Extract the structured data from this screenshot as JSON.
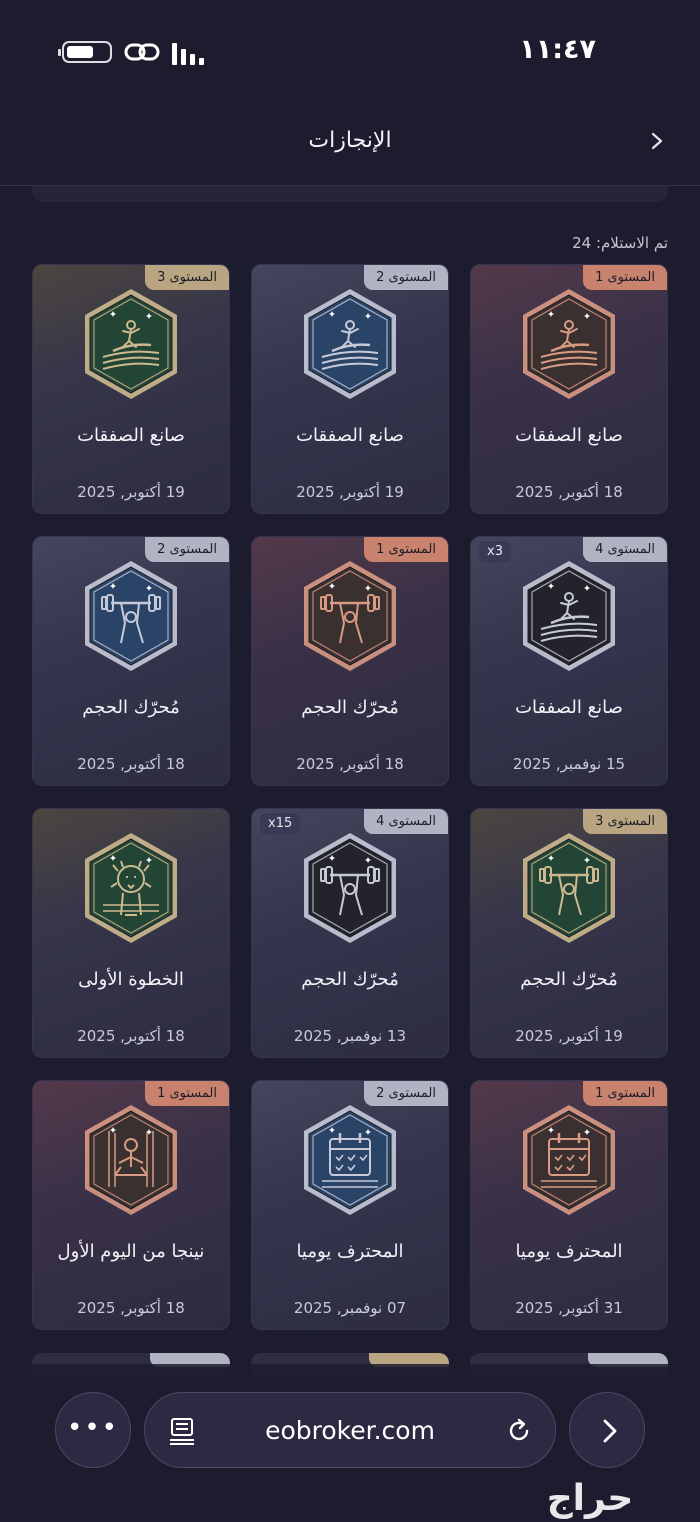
{
  "status_bar": {
    "time": "١١:٤٧"
  },
  "header": {
    "title": "الإنجازات"
  },
  "received_label": "تم الاستلام: 24",
  "achievements": [
    {
      "level": "المستوى 1",
      "tier": "bronze",
      "title": "صانع الصفقات",
      "date": "18 أكتوبر, 2025",
      "icon": "surfer-icon"
    },
    {
      "level": "المستوى 2",
      "tier": "silver",
      "title": "صانع الصفقات",
      "date": "19 أكتوبر, 2025",
      "icon": "surfer-icon"
    },
    {
      "level": "المستوى 3",
      "tier": "gold",
      "title": "صانع الصفقات",
      "date": "19 أكتوبر, 2025",
      "icon": "surfer-icon"
    },
    {
      "level": "المستوى 4",
      "tier": "silver",
      "count": "x3",
      "title": "صانع الصفقات",
      "date": "15 نوفمبر, 2025",
      "icon": "surfer-icon"
    },
    {
      "level": "المستوى 1",
      "tier": "bronze",
      "title": "مُحرّك الحجم",
      "date": "18 أكتوبر, 2025",
      "icon": "weightlifter-icon"
    },
    {
      "level": "المستوى 2",
      "tier": "silver",
      "title": "مُحرّك الحجم",
      "date": "18 أكتوبر, 2025",
      "icon": "weightlifter-icon"
    },
    {
      "level": "المستوى 3",
      "tier": "gold",
      "title": "مُحرّك الحجم",
      "date": "19 أكتوبر, 2025",
      "icon": "weightlifter-icon"
    },
    {
      "level": "المستوى 4",
      "tier": "silver",
      "count": "x15",
      "title": "مُحرّك الحجم",
      "date": "13 نوفمبر, 2025",
      "icon": "weightlifter-icon"
    },
    {
      "level": "",
      "tier": "gold",
      "title": "الخطوة الأولى",
      "date": "18 أكتوبر, 2025",
      "icon": "lion-icon"
    },
    {
      "level": "المستوى 1",
      "tier": "bronze",
      "title": "المحترف يوميا",
      "date": "31 أكتوبر, 2025",
      "icon": "calendar-icon"
    },
    {
      "level": "المستوى 2",
      "tier": "silver",
      "title": "المحترف يوميا",
      "date": "07 نوفمبر, 2025",
      "icon": "calendar-icon"
    },
    {
      "level": "المستوى 1",
      "tier": "bronze",
      "title": "نينجا من اليوم الأول",
      "date": "18 أكتوبر, 2025",
      "icon": "ninja-icon"
    }
  ],
  "colors": {
    "bronze": "#c9826e",
    "silver": "#b2b3c2",
    "gold": "#b9a581",
    "badge_bg_bronze": "#2f2d33",
    "badge_bg_silver_blue": "#2a4468",
    "badge_bg_silver_dark": "#23232b",
    "badge_bg_gold": "#234535"
  },
  "browser": {
    "url": "eobroker.com"
  },
  "watermark": "حراج"
}
